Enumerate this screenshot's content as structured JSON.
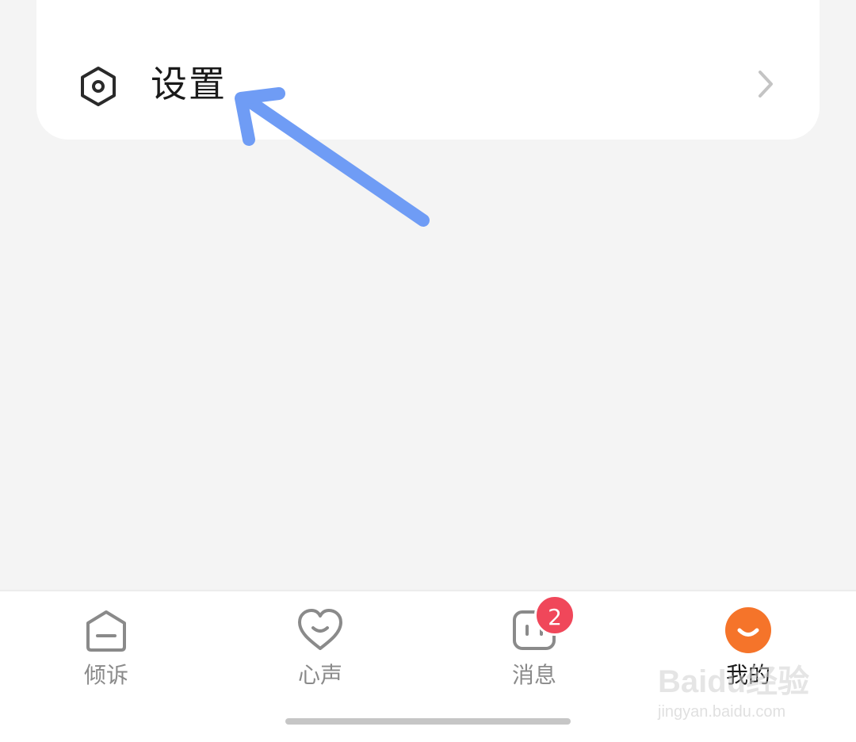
{
  "settings": {
    "label": "设置",
    "icon": "hexagon-settings-icon"
  },
  "tabs": [
    {
      "label": "倾诉",
      "icon": "house-icon",
      "active": false
    },
    {
      "label": "心声",
      "icon": "heart-icon",
      "active": false
    },
    {
      "label": "消息",
      "icon": "message-icon",
      "active": false,
      "badge": "2"
    },
    {
      "label": "我的",
      "icon": "smile-avatar-icon",
      "active": true
    }
  ],
  "watermark": {
    "main": "Baidu经验",
    "sub": "jingyan.baidu.com"
  },
  "colors": {
    "background": "#f4f4f4",
    "card": "#ffffff",
    "annotation_arrow": "#6f9cf5",
    "badge": "#f0475a",
    "profile_accent": "#f5742a"
  }
}
